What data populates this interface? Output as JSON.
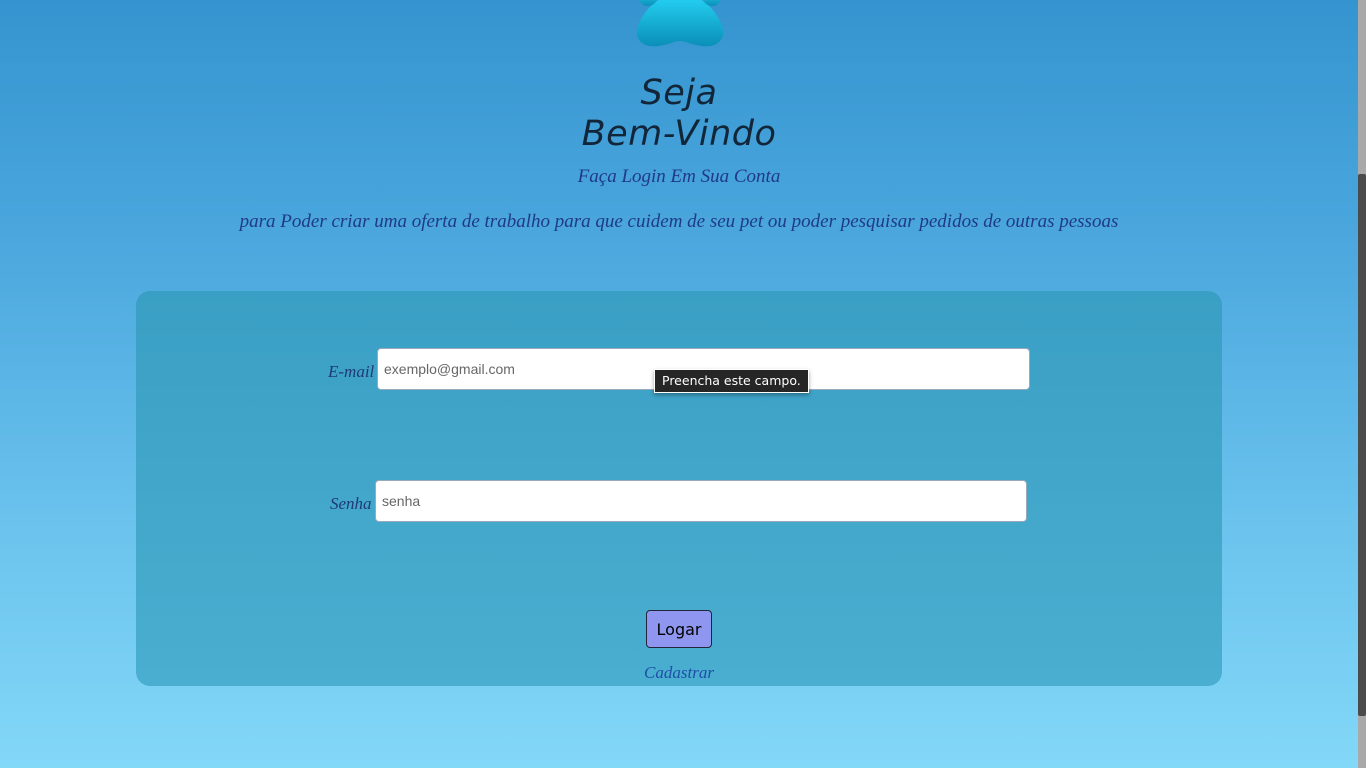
{
  "header": {
    "logo_icon": "paw-icon",
    "title_line1": "Seja",
    "title_line2": "Bem-Vindo",
    "subtitle": "Faça Login Em Sua Conta",
    "description": "para Poder criar uma oferta de trabalho para que cuidem de seu pet ou poder pesquisar pedidos de outras pessoas"
  },
  "form": {
    "email": {
      "label": "E-mail",
      "value": "",
      "placeholder": "exemplo@gmail.com"
    },
    "password": {
      "label": "Senha",
      "value": "",
      "placeholder": "senha"
    },
    "validation_tooltip": "Preencha este campo.",
    "submit_label": "Logar",
    "register_link": "Cadastrar"
  },
  "colors": {
    "background_top": "#3594cf",
    "background_bottom": "#83d8f8",
    "card": "#3fa6c9",
    "button": "#8f96f0",
    "heading": "#12263a",
    "text": "#1f3a86"
  }
}
